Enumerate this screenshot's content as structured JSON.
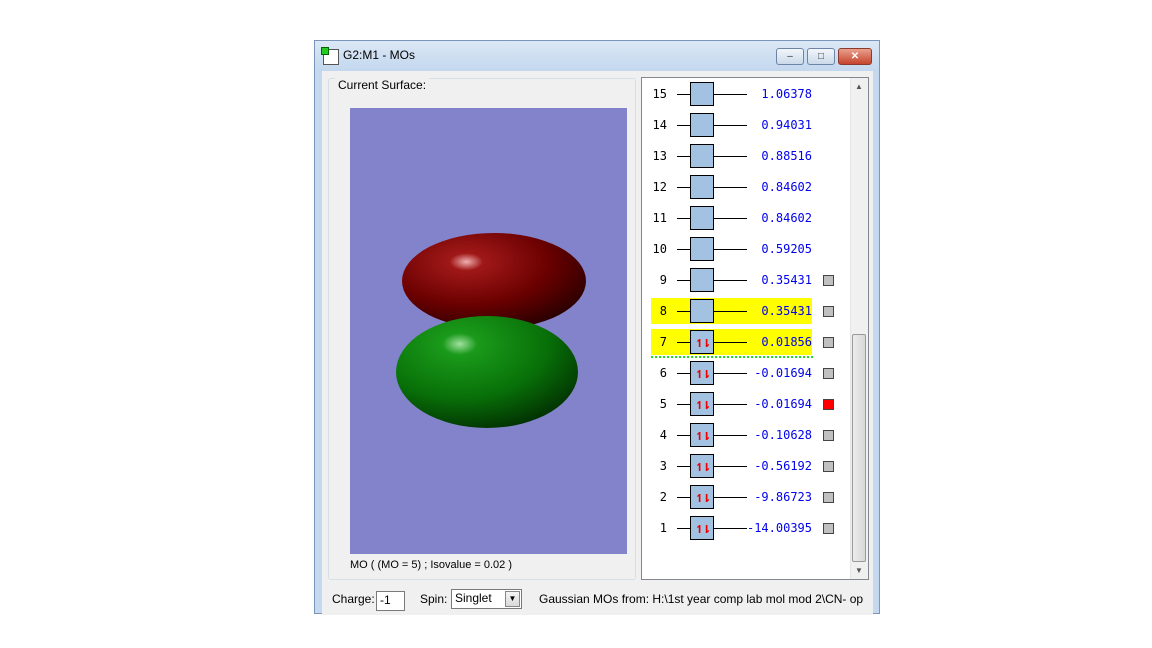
{
  "window": {
    "title": "G2:M1 - MOs",
    "minimize": "–",
    "maximize": "□",
    "close": "✕"
  },
  "surface": {
    "group_label": "Current Surface:",
    "mo_label": "MO ( (MO = 5) ; Isovalue = 0.02 )",
    "colors": {
      "background": "#8383cb",
      "positive": "#8b0000",
      "negative": "#0a8a0a"
    }
  },
  "orbitals": [
    {
      "n": "15",
      "occ": "",
      "energy": "1.06378",
      "hl": false,
      "marker": "none"
    },
    {
      "n": "14",
      "occ": "",
      "energy": "0.94031",
      "hl": false,
      "marker": "none"
    },
    {
      "n": "13",
      "occ": "",
      "energy": "0.88516",
      "hl": false,
      "marker": "none"
    },
    {
      "n": "12",
      "occ": "",
      "energy": "0.84602",
      "hl": false,
      "marker": "none"
    },
    {
      "n": "11",
      "occ": "",
      "energy": "0.84602",
      "hl": false,
      "marker": "none"
    },
    {
      "n": "10",
      "occ": "",
      "energy": "0.59205",
      "hl": false,
      "marker": "none"
    },
    {
      "n": "9",
      "occ": "",
      "energy": "0.35431",
      "hl": false,
      "marker": "gray"
    },
    {
      "n": "8",
      "occ": "",
      "energy": "0.35431",
      "hl": true,
      "marker": "gray"
    },
    {
      "n": "7",
      "occ": "↿⇂",
      "energy": "0.01856",
      "hl": true,
      "marker": "gray"
    },
    {
      "n": "6",
      "occ": "↿⇂",
      "energy": "-0.01694",
      "hl": false,
      "marker": "gray"
    },
    {
      "n": "5",
      "occ": "↿⇂",
      "energy": "-0.01694",
      "hl": false,
      "marker": "red"
    },
    {
      "n": "4",
      "occ": "↿⇂",
      "energy": "-0.10628",
      "hl": false,
      "marker": "gray"
    },
    {
      "n": "3",
      "occ": "↿⇂",
      "energy": "-0.56192",
      "hl": false,
      "marker": "gray"
    },
    {
      "n": "2",
      "occ": "↿⇂",
      "energy": "-9.86723",
      "hl": false,
      "marker": "gray"
    },
    {
      "n": "1",
      "occ": "↿⇂",
      "energy": "-14.00395",
      "hl": false,
      "marker": "gray"
    }
  ],
  "bottom": {
    "charge_label": "Charge:",
    "charge_value": "-1",
    "spin_label": "Spin:",
    "spin_value": "Singlet",
    "source_text": "Gaussian MOs from:  H:\\1st year comp lab mol mod 2\\CN- op"
  }
}
